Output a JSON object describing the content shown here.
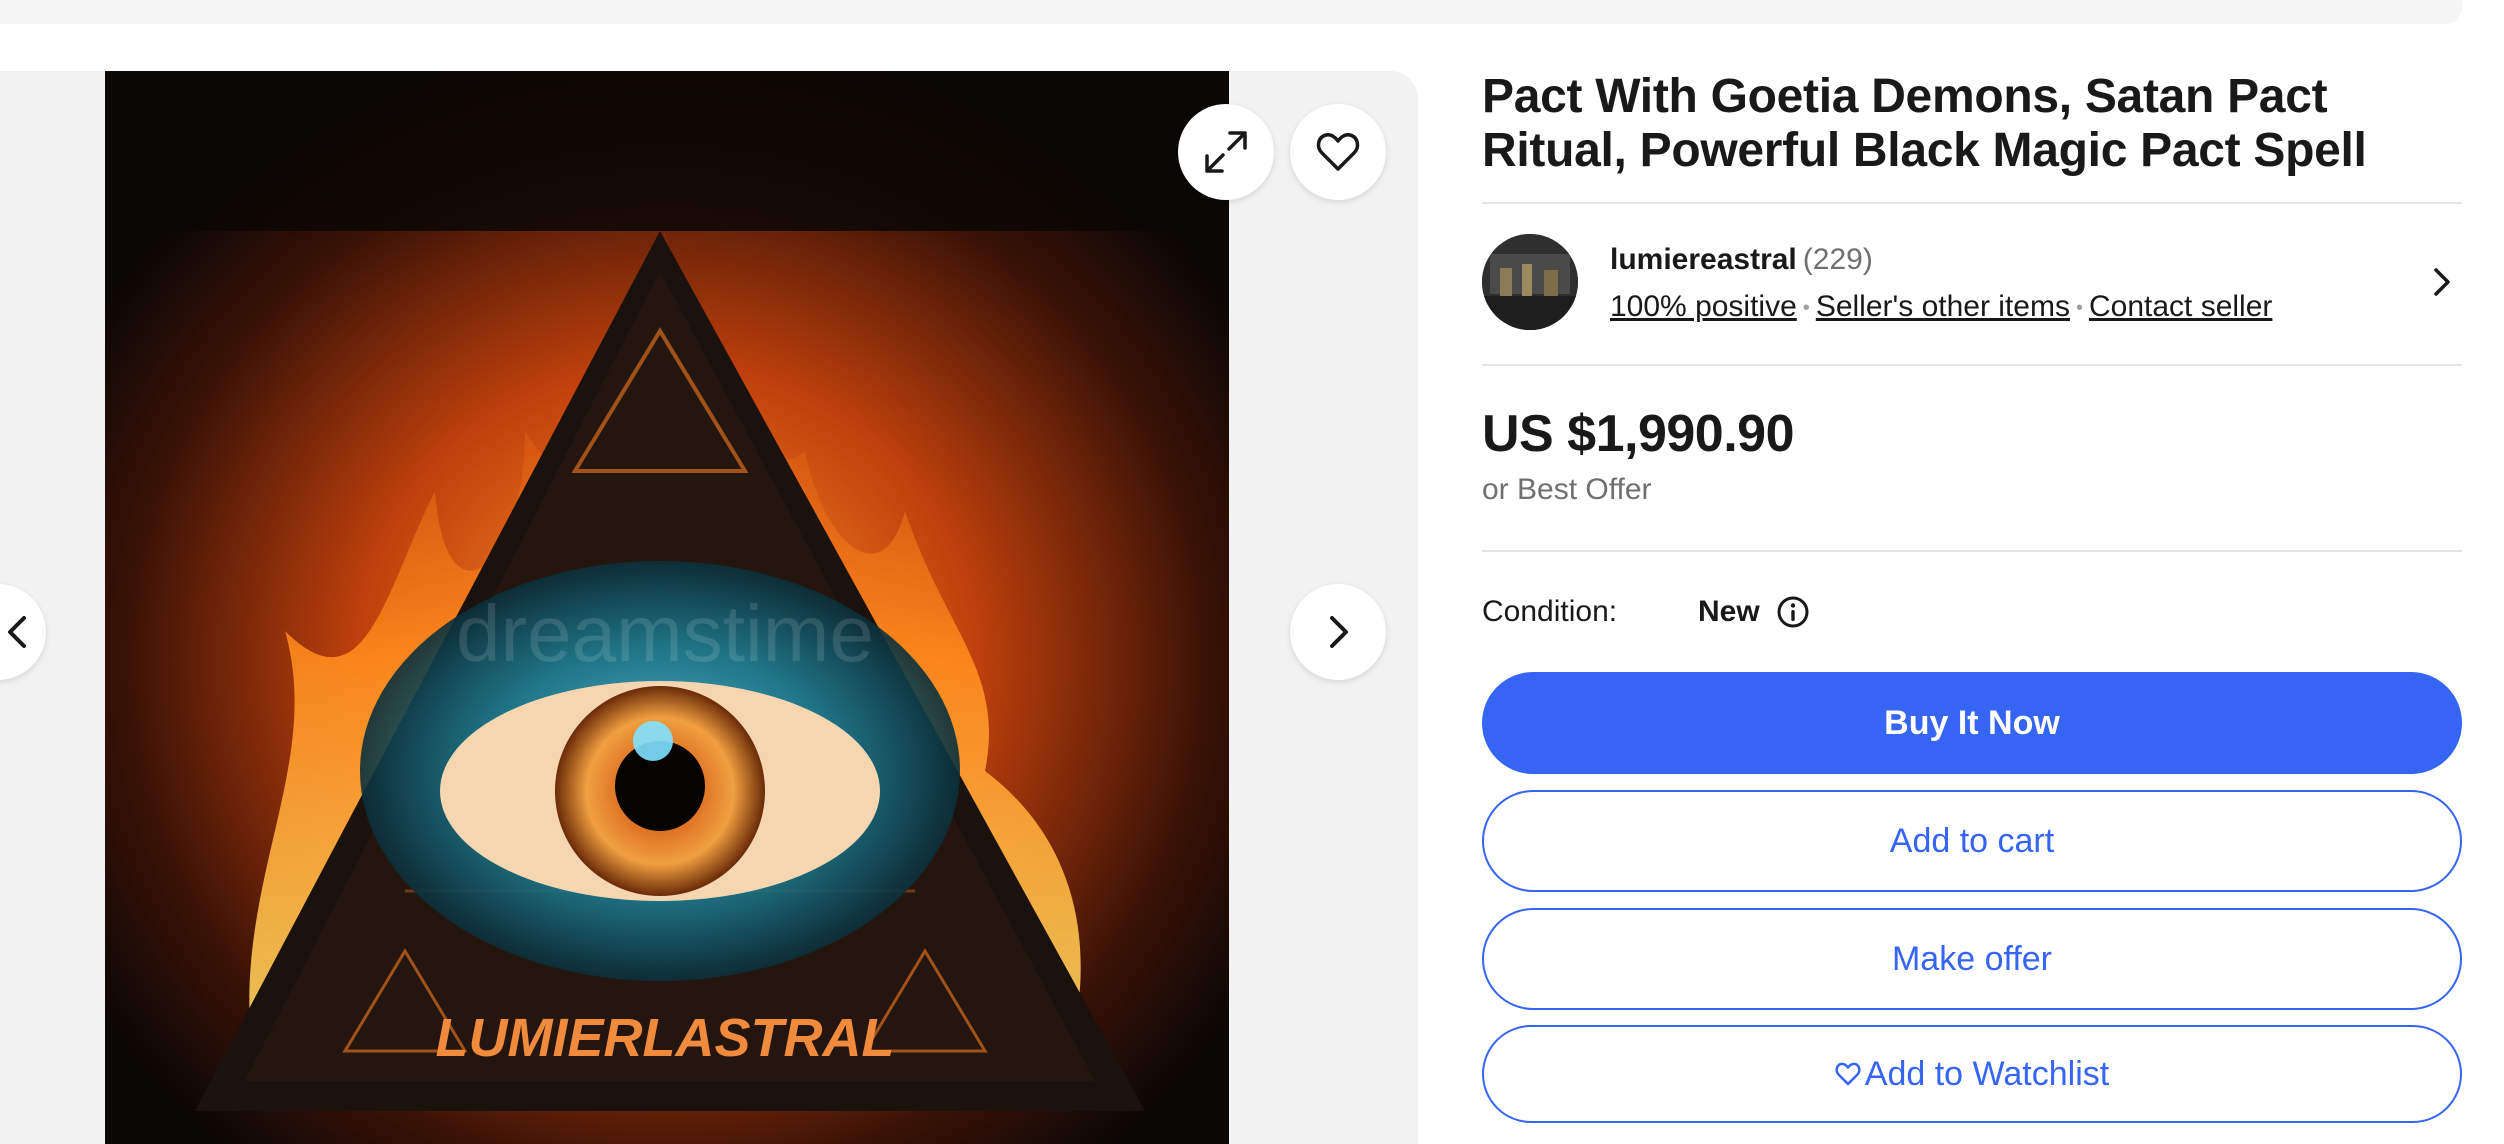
{
  "listing": {
    "title": "Pact With Goetia Demons, Satan Pact Ritual, Powerful Black Magic Pact Spell",
    "image_watermark": "dreamstime",
    "image_caption": "LUMIERLASTRAL"
  },
  "seller": {
    "name": "lumiereastral",
    "feedback_count": "(229)",
    "positive": "100% positive",
    "other_items": "Seller's other items",
    "contact": "Contact seller"
  },
  "price": {
    "amount": "US $1,990.90",
    "best_offer": "or Best Offer"
  },
  "condition": {
    "label": "Condition:",
    "value": "New"
  },
  "actions": {
    "buy_now": "Buy It Now",
    "add_to_cart": "Add to cart",
    "make_offer": "Make offer",
    "add_to_watchlist": "Add to Watchlist"
  },
  "icons": {
    "expand": "expand-icon",
    "favorite": "heart-icon",
    "prev": "chevron-left-icon",
    "next": "chevron-right-icon",
    "seller_more": "chevron-right-icon",
    "info": "info-icon",
    "watch": "heart-icon"
  },
  "colors": {
    "primary": "#3665f3",
    "text": "#191919",
    "secondary_text": "#707070",
    "divider": "#e5e5e5",
    "gallery_bg": "#f2f2f2"
  }
}
